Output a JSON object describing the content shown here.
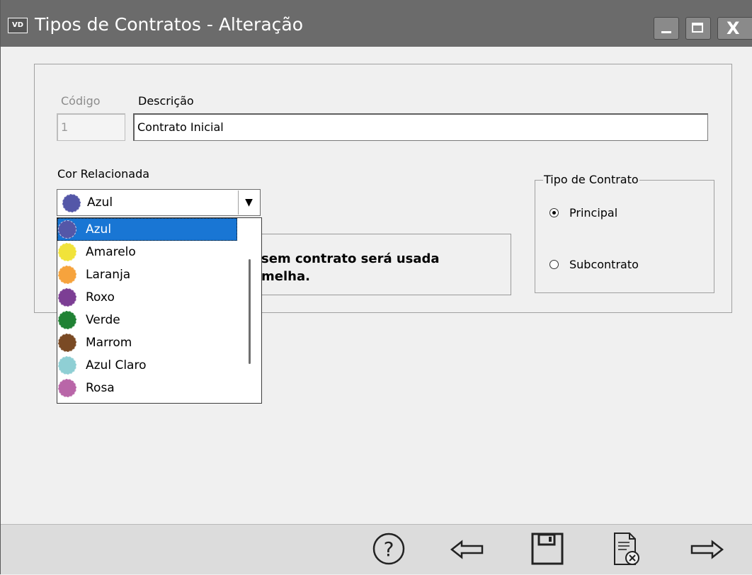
{
  "window": {
    "app_icon_text": "VD",
    "title": "Tipos de Contratos - Alteração"
  },
  "form": {
    "codigo_label": "Código",
    "codigo_value": "1",
    "descricao_label": "Descrição",
    "descricao_value": "Contrato Inicial",
    "cor_label": "Cor Relacionada",
    "cor_selected": "Azul",
    "cor_selected_color": "#5457a8",
    "cor_options": [
      {
        "label": "Azul",
        "color": "#5457a8"
      },
      {
        "label": "Amarelo",
        "color": "#f1e33a"
      },
      {
        "label": "Laranja",
        "color": "#f6a33d"
      },
      {
        "label": "Roxo",
        "color": "#7c3e94"
      },
      {
        "label": "Verde",
        "color": "#208234"
      },
      {
        "label": "Marrom",
        "color": "#7a4a24"
      },
      {
        "label": "Azul Claro",
        "color": "#8fcfd4"
      },
      {
        "label": "Rosa",
        "color": "#b966a8"
      }
    ],
    "info_line1": "sem contrato será usada",
    "info_line2": "melha."
  },
  "tipo_contrato": {
    "legend": "Tipo de Contrato",
    "options": [
      {
        "label": "Principal",
        "checked": true
      },
      {
        "label": "Subcontrato",
        "checked": false
      }
    ]
  },
  "colors": {
    "titlebar": "#6b6b6b",
    "selection": "#1976d4"
  },
  "toolbar": {
    "icons": [
      "help-icon",
      "back-arrow-icon",
      "save-icon",
      "cancel-document-icon",
      "forward-arrow-icon"
    ]
  }
}
